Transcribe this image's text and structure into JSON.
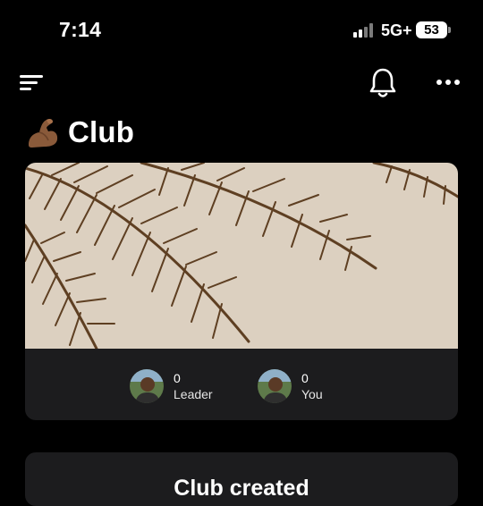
{
  "status_bar": {
    "time": "7:14",
    "network": "5G+",
    "battery": "53",
    "icons": [
      "cellular-signal-icon",
      "battery-icon"
    ]
  },
  "header": {
    "icons": [
      "menu-icon",
      "bell-icon",
      "more-icon"
    ]
  },
  "page": {
    "title_emoji": "flexed-biceps-icon",
    "title": "Club"
  },
  "club_card": {
    "banner": "palm-leaves-image",
    "members": [
      {
        "score": "0",
        "label": "Leader",
        "avatar": "avatar-image"
      },
      {
        "score": "0",
        "label": "You",
        "avatar": "avatar-image"
      }
    ]
  },
  "created_card": {
    "title": "Club created"
  },
  "colors": {
    "background": "#000000",
    "card": "#1c1c1e",
    "text": "#ffffff",
    "banner_sky": "#dcd0c0",
    "palm": "#5e3f22"
  }
}
